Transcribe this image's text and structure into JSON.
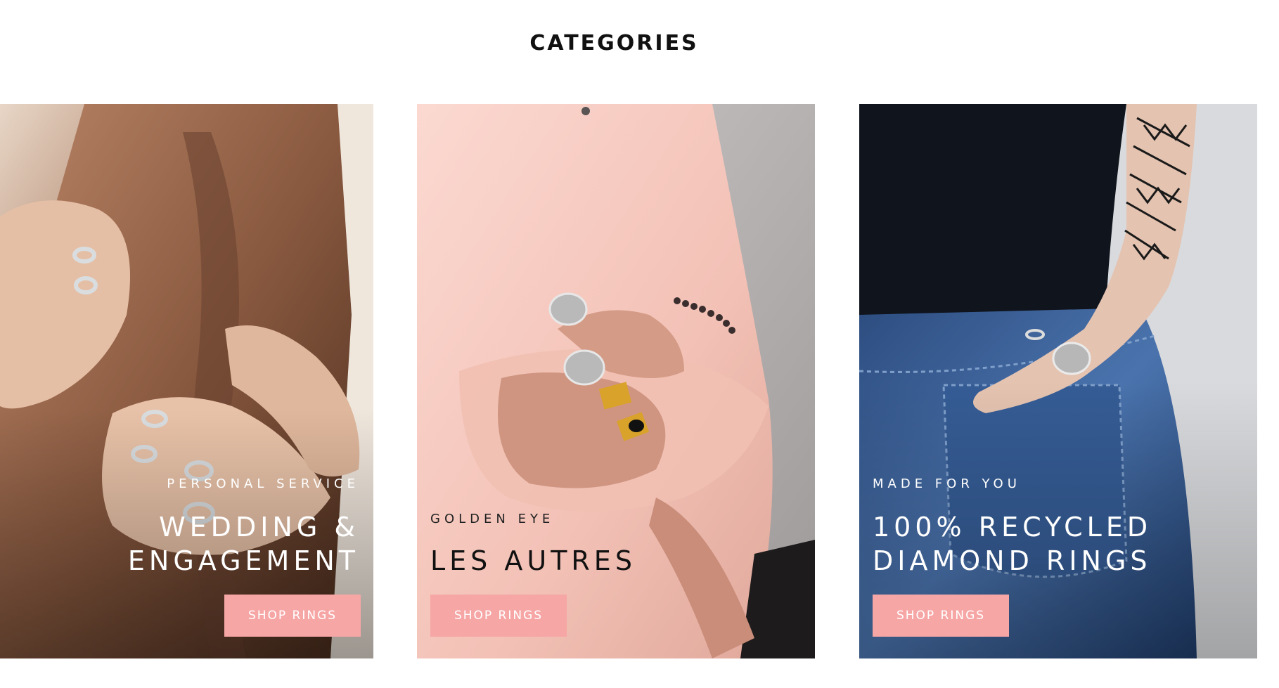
{
  "section": {
    "title": "CATEGORIES"
  },
  "cards": [
    {
      "kicker": "PERSONAL SERVICE",
      "heading_line1": "WEDDING &",
      "heading_line2": "ENGAGEMENT",
      "button_label": "SHOP RINGS",
      "image_alt": "Hands wearing silver rings on a brown leather jacket"
    },
    {
      "kicker": "GOLDEN EYE",
      "heading_line1": "LES AUTRES",
      "heading_line2": "",
      "button_label": "SHOP RINGS",
      "image_alt": "Person in pink sweatshirt wearing silver and gold signet rings"
    },
    {
      "kicker": "MADE FOR YOU",
      "heading_line1": "100% RECYCLED",
      "heading_line2": "DIAMOND RINGS",
      "button_label": "SHOP RINGS",
      "image_alt": "Tattooed arm with lion ring over blue jeans pocket"
    }
  ],
  "colors": {
    "button_bg": "#f7a6a6",
    "button_text": "#ffffff",
    "title_text": "#111111"
  }
}
